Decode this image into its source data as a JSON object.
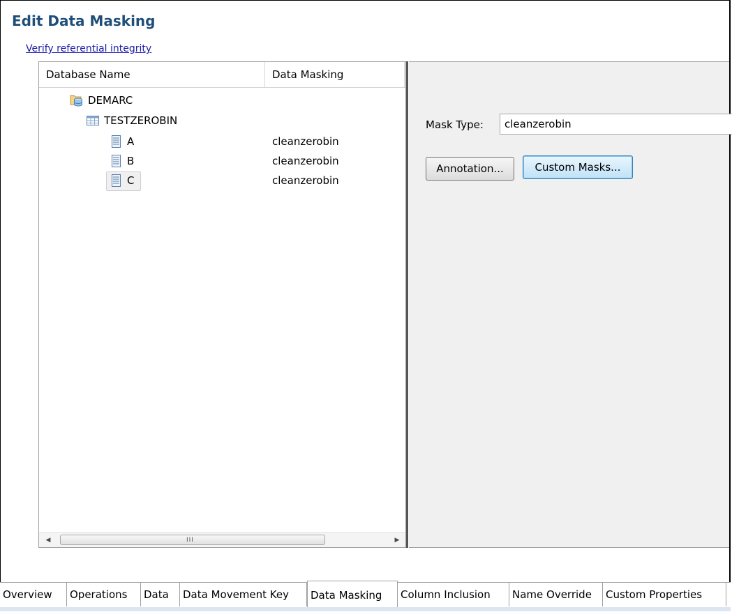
{
  "editor": {
    "title": "Edit Data Masking",
    "verify_link": "Verify referential integrity"
  },
  "tree": {
    "columns": [
      "Database Name",
      "Data Masking"
    ],
    "rows": [
      {
        "label": "DEMARC",
        "mask": "",
        "icon": "database-icon",
        "level": 0
      },
      {
        "label": "TESTZEROBIN",
        "mask": "",
        "icon": "table-icon",
        "level": 1
      },
      {
        "label": "A",
        "mask": "cleanzerobin",
        "icon": "column-icon",
        "level": 2
      },
      {
        "label": "B",
        "mask": "cleanzerobin",
        "icon": "column-icon",
        "level": 2
      },
      {
        "label": "C",
        "mask": "cleanzerobin",
        "icon": "column-icon",
        "level": 2,
        "selected": true
      }
    ],
    "scrollbar_grip": "III"
  },
  "props": {
    "mask_type_label": "Mask Type:",
    "mask_type_value": "cleanzerobin",
    "annotation_button": "Annotation...",
    "custom_masks_button": "Custom Masks..."
  },
  "tabs": [
    {
      "label": "Overview"
    },
    {
      "label": "Operations"
    },
    {
      "label": "Data"
    },
    {
      "label": "Data Movement Key"
    },
    {
      "label": "Data Masking",
      "active": true
    },
    {
      "label": "Column Inclusion"
    },
    {
      "label": "Name Override"
    },
    {
      "label": "Custom Properties"
    }
  ],
  "colors": {
    "title": "#1f4e79",
    "link": "#1c1ca8",
    "panel_bg": "#f0f0f0"
  }
}
